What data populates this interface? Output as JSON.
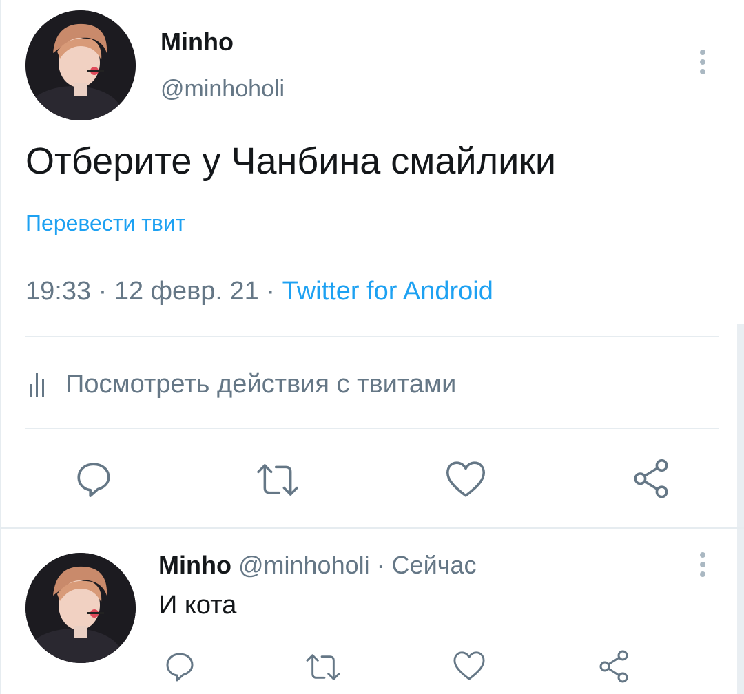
{
  "tweet": {
    "author_name": "Minho",
    "author_handle": "@minhoholi",
    "text": "Отберите у Чанбина смайлики",
    "translate_label": "Перевести твит",
    "time": "19:33",
    "date": "12 февр. 21",
    "separator": " · ",
    "source": "Twitter for Android",
    "analytics_label": "Посмотреть действия с твитами",
    "actions": [
      "reply-icon",
      "retweet-icon",
      "like-icon",
      "share-icon"
    ],
    "colors": {
      "link": "#1da1f2",
      "secondary": "#657786",
      "icon": "#657786"
    }
  },
  "reply": {
    "author_name": "Minho",
    "author_handle": "@minhoholi",
    "separator": " · ",
    "time": "Сейчас",
    "text": "И кота",
    "actions": [
      "reply-icon",
      "retweet-icon",
      "like-icon",
      "share-icon"
    ]
  }
}
